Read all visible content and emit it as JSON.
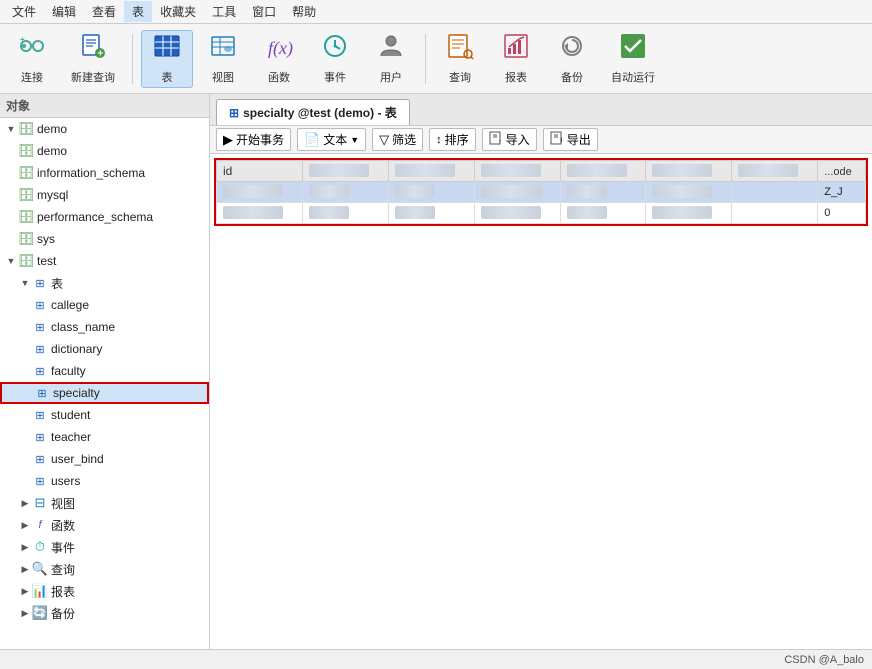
{
  "menubar": {
    "items": [
      "文件",
      "编辑",
      "查看",
      "表",
      "收藏夹",
      "工具",
      "窗口",
      "帮助"
    ]
  },
  "toolbar": {
    "buttons": [
      {
        "id": "connect",
        "icon": "🔗",
        "label": "连接",
        "active": false
      },
      {
        "id": "new-query",
        "icon": "📋",
        "label": "新建查询",
        "active": false
      },
      {
        "id": "table",
        "icon": "⊞",
        "label": "表",
        "active": true
      },
      {
        "id": "view",
        "icon": "👁",
        "label": "视图",
        "active": false
      },
      {
        "id": "function",
        "icon": "f(x)",
        "label": "函数",
        "active": false
      },
      {
        "id": "event",
        "icon": "⏱",
        "label": "事件",
        "active": false
      },
      {
        "id": "user",
        "icon": "👤",
        "label": "用户",
        "active": false
      },
      {
        "id": "query",
        "icon": "🔍",
        "label": "查询",
        "active": false
      },
      {
        "id": "report",
        "icon": "📊",
        "label": "报表",
        "active": false
      },
      {
        "id": "backup",
        "icon": "🔄",
        "label": "备份",
        "active": false
      },
      {
        "id": "autorun",
        "icon": "☑",
        "label": "自动运行",
        "active": false
      }
    ]
  },
  "sidebar": {
    "obj_label": "对象",
    "databases": [
      {
        "name": "demo",
        "expanded": true,
        "children": [
          {
            "name": "demo",
            "type": "db"
          },
          {
            "name": "information_schema",
            "type": "db"
          },
          {
            "name": "mysql",
            "type": "db"
          },
          {
            "name": "performance_schema",
            "type": "db"
          },
          {
            "name": "sys",
            "type": "db"
          }
        ]
      },
      {
        "name": "test",
        "expanded": true,
        "children": [
          {
            "name": "表",
            "type": "folder",
            "expanded": true,
            "children": [
              {
                "name": "callege",
                "type": "table"
              },
              {
                "name": "class_name",
                "type": "table"
              },
              {
                "name": "dictionary",
                "type": "table"
              },
              {
                "name": "faculty",
                "type": "table"
              },
              {
                "name": "specialty",
                "type": "table",
                "selected": true
              },
              {
                "name": "student",
                "type": "table"
              },
              {
                "name": "teacher",
                "type": "table"
              },
              {
                "name": "user_bind",
                "type": "table"
              },
              {
                "name": "users",
                "type": "table"
              }
            ]
          },
          {
            "name": "视图",
            "type": "folder-view"
          },
          {
            "name": "函数",
            "type": "folder-func"
          },
          {
            "name": "事件",
            "type": "folder-event"
          },
          {
            "name": "查询",
            "type": "folder-query"
          },
          {
            "name": "报表",
            "type": "folder-report"
          },
          {
            "name": "备份",
            "type": "folder-backup"
          }
        ]
      }
    ]
  },
  "tab": {
    "label": "specialty @test (demo) - 表",
    "icon": "⊞"
  },
  "tab_toolbar": {
    "buttons": [
      {
        "id": "begin-tx",
        "icon": "▶",
        "label": "开始事务"
      },
      {
        "id": "text",
        "icon": "📄",
        "label": "文本",
        "has_arrow": true
      },
      {
        "id": "filter",
        "icon": "▽",
        "label": "筛选"
      },
      {
        "id": "sort",
        "icon": "↕",
        "label": "排序"
      },
      {
        "id": "import",
        "icon": "📥",
        "label": "导入"
      },
      {
        "id": "export",
        "icon": "📤",
        "label": "导出"
      }
    ]
  },
  "table_data": {
    "columns": [
      "id",
      "col2",
      "col3",
      "col4",
      "col5",
      "col6",
      "col7",
      "code"
    ],
    "rows": [
      {
        "id": "1",
        "selected": true
      },
      {
        "id": "2",
        "selected": false
      }
    ]
  },
  "statusbar": {
    "text": "CSDN @A_balo"
  }
}
